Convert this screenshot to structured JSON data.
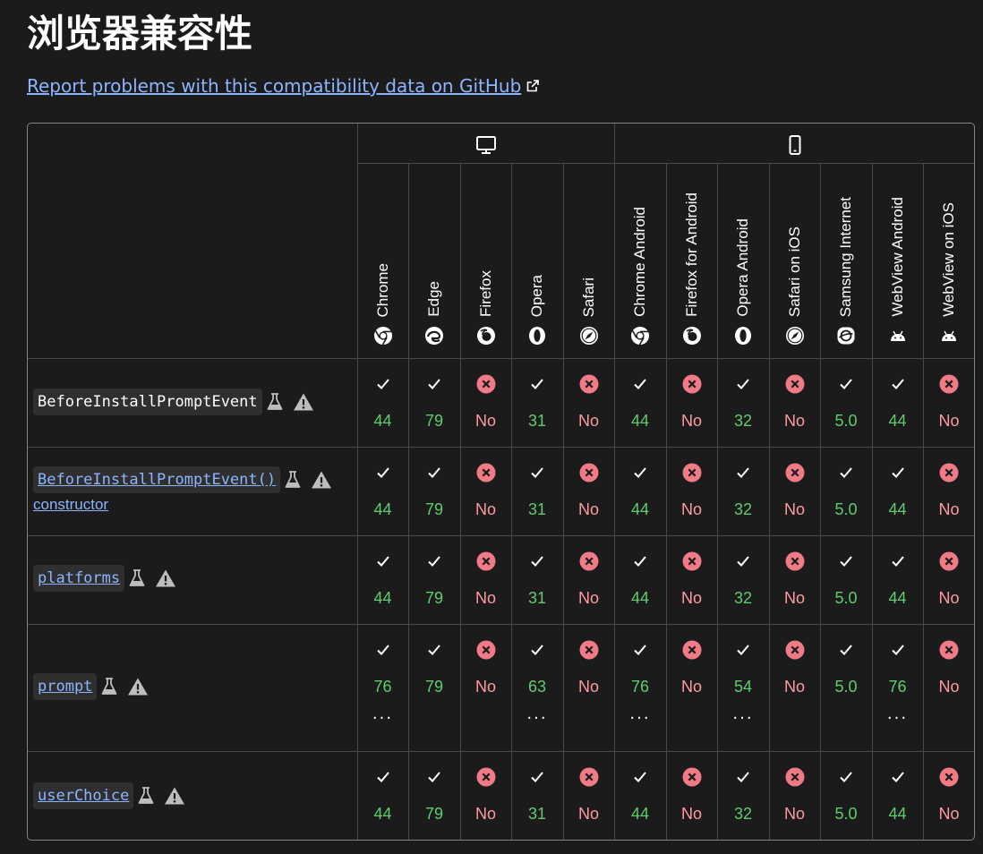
{
  "page": {
    "title": "浏览器兼容性",
    "report_link": "Report problems with this compatibility data on GitHub"
  },
  "platforms": [
    {
      "name": "desktop",
      "icon": "desktop-icon"
    },
    {
      "name": "mobile",
      "icon": "mobile-icon"
    }
  ],
  "browsers": [
    {
      "name": "Chrome",
      "icon": "chrome-icon"
    },
    {
      "name": "Edge",
      "icon": "edge-icon"
    },
    {
      "name": "Firefox",
      "icon": "firefox-icon"
    },
    {
      "name": "Opera",
      "icon": "opera-icon"
    },
    {
      "name": "Safari",
      "icon": "safari-icon"
    },
    {
      "name": "Chrome Android",
      "icon": "chrome-icon"
    },
    {
      "name": "Firefox for Android",
      "icon": "firefox-icon"
    },
    {
      "name": "Opera Android",
      "icon": "opera-icon"
    },
    {
      "name": "Safari on iOS",
      "icon": "safari-icon"
    },
    {
      "name": "Samsung Internet",
      "icon": "samsung-internet-icon"
    },
    {
      "name": "WebView Android",
      "icon": "android-icon"
    },
    {
      "name": "WebView on iOS",
      "icon": "android-icon"
    }
  ],
  "features": [
    {
      "name": "BeforeInstallPromptEvent",
      "link": false,
      "suffix": "",
      "support": [
        "44",
        "79",
        "No",
        "31",
        "No",
        "44",
        "No",
        "32",
        "No",
        "5.0",
        "44",
        "No"
      ],
      "more": [
        false,
        false,
        false,
        false,
        false,
        false,
        false,
        false,
        false,
        false,
        false,
        false
      ]
    },
    {
      "name": "BeforeInstallPromptEvent()",
      "link": true,
      "suffix": "constructor",
      "support": [
        "44",
        "79",
        "No",
        "31",
        "No",
        "44",
        "No",
        "32",
        "No",
        "5.0",
        "44",
        "No"
      ],
      "more": [
        false,
        false,
        false,
        false,
        false,
        false,
        false,
        false,
        false,
        false,
        false,
        false
      ]
    },
    {
      "name": "platforms",
      "link": true,
      "suffix": "",
      "support": [
        "44",
        "79",
        "No",
        "31",
        "No",
        "44",
        "No",
        "32",
        "No",
        "5.0",
        "44",
        "No"
      ],
      "more": [
        false,
        false,
        false,
        false,
        false,
        false,
        false,
        false,
        false,
        false,
        false,
        false
      ]
    },
    {
      "name": "prompt",
      "link": true,
      "suffix": "",
      "support": [
        "76",
        "79",
        "No",
        "63",
        "No",
        "76",
        "No",
        "54",
        "No",
        "5.0",
        "76",
        "No"
      ],
      "more": [
        true,
        false,
        false,
        true,
        false,
        true,
        false,
        true,
        false,
        false,
        true,
        false
      ]
    },
    {
      "name": "userChoice",
      "link": true,
      "suffix": "",
      "support": [
        "44",
        "79",
        "No",
        "31",
        "No",
        "44",
        "No",
        "32",
        "No",
        "5.0",
        "44",
        "No"
      ],
      "more": [
        false,
        false,
        false,
        false,
        false,
        false,
        false,
        false,
        false,
        false,
        false,
        false
      ]
    }
  ],
  "more_label": "···",
  "colors": {
    "background": "#1b1b1b",
    "link": "#8cb4ff",
    "supported": "#5fcc6d",
    "unsupported_text": "#ff9aa2",
    "unsupported_icon": "#f07a85"
  }
}
